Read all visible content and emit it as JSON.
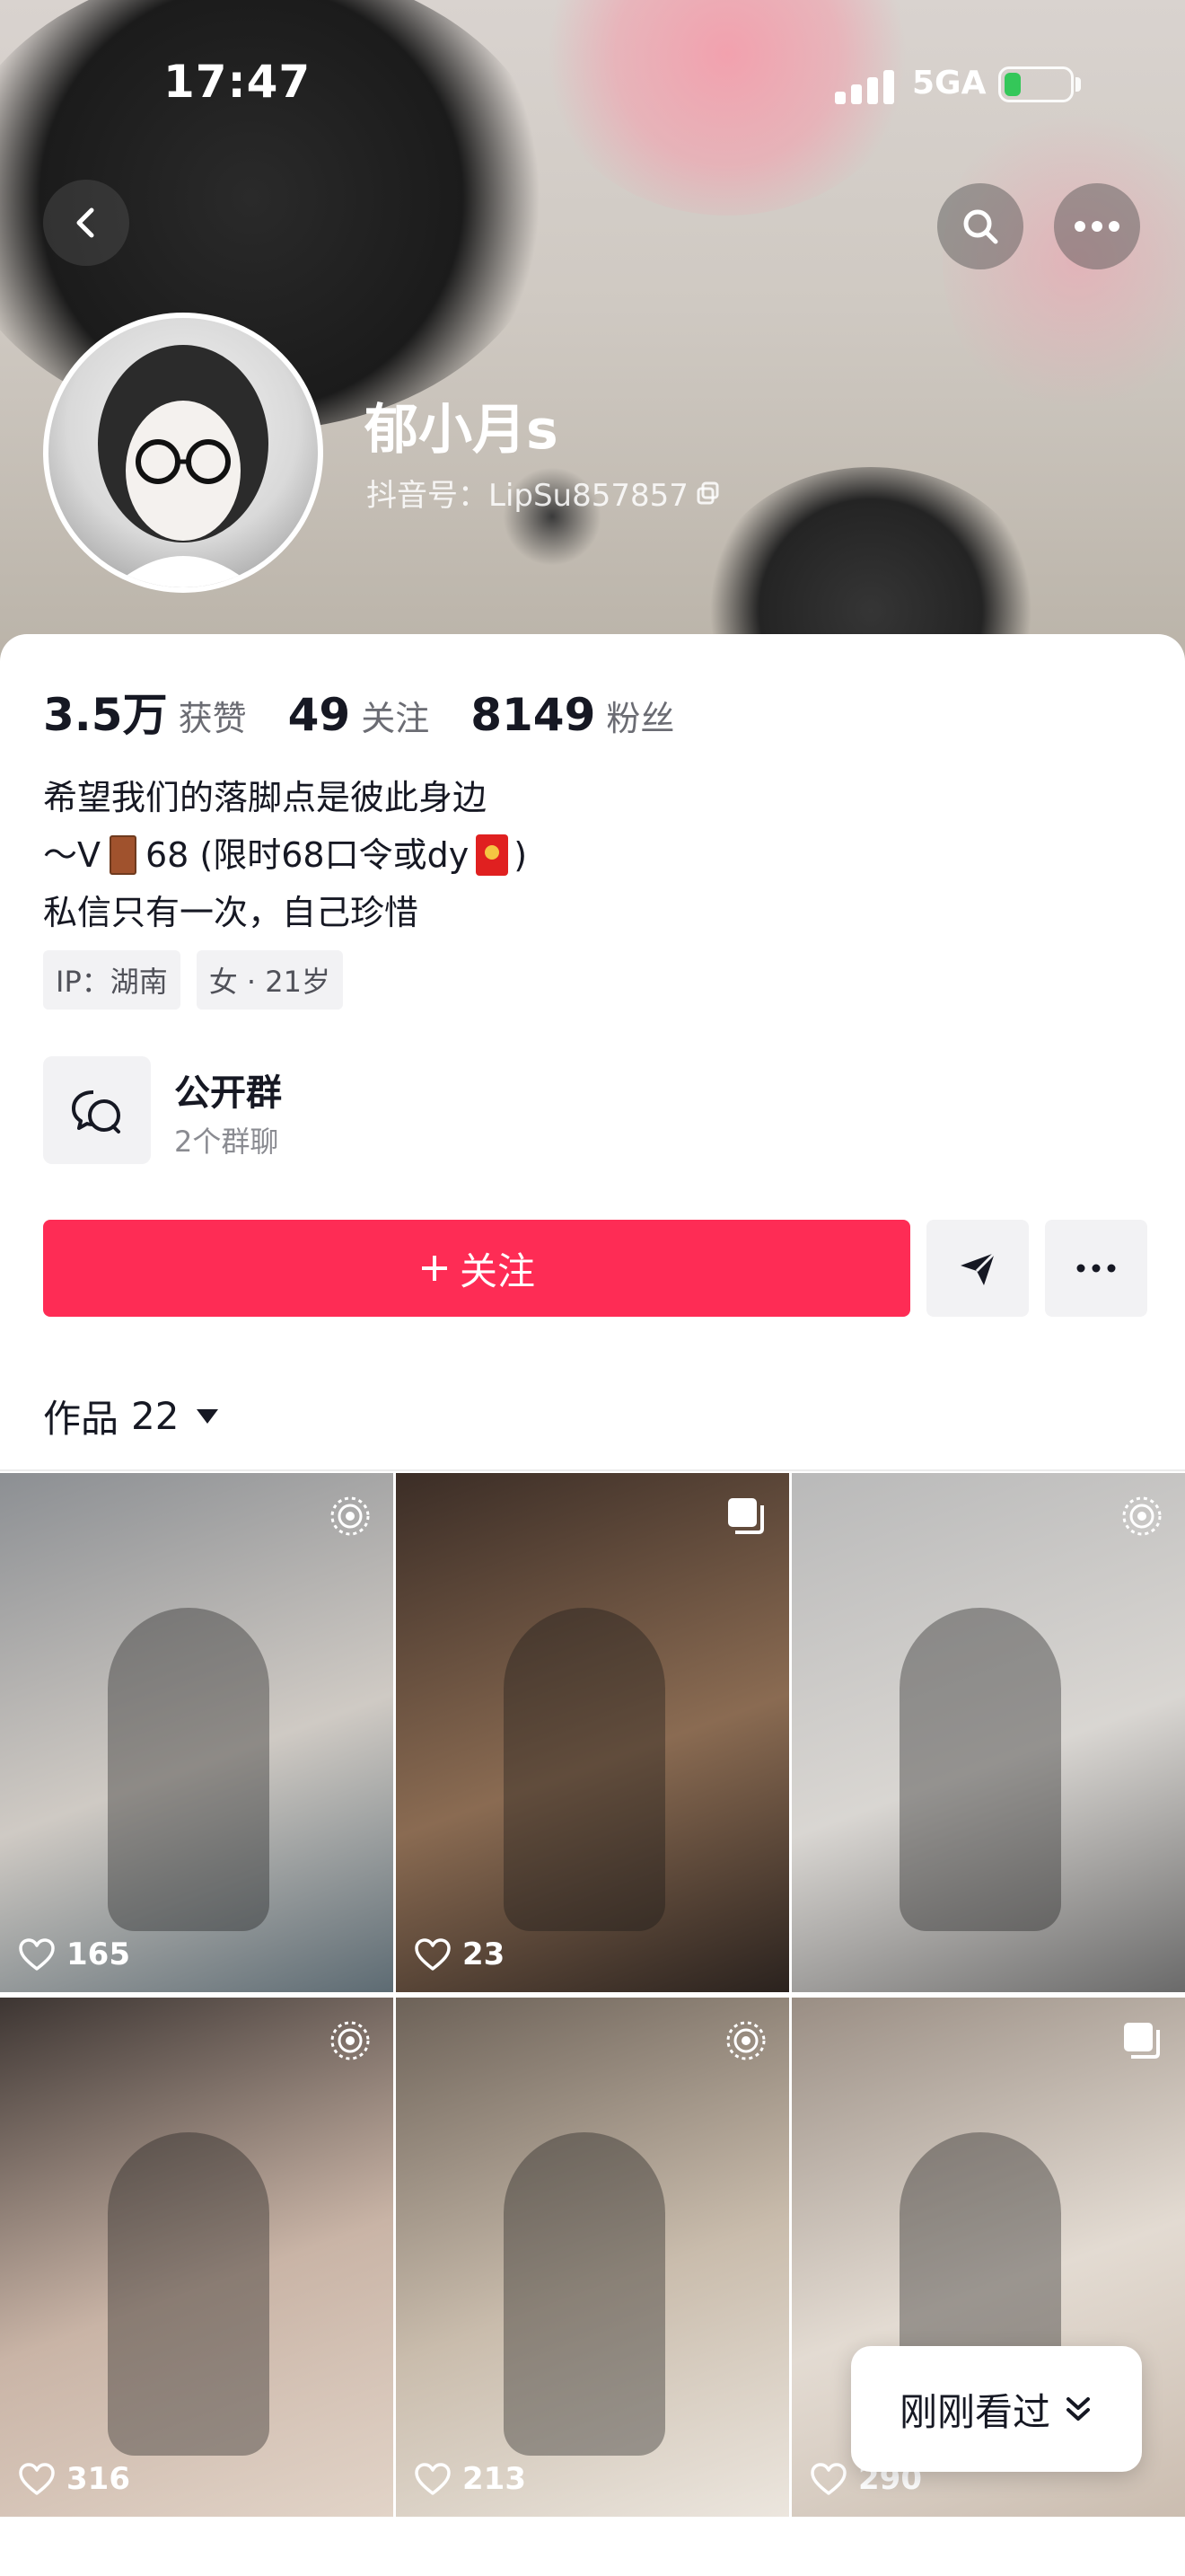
{
  "status_bar": {
    "time": "17:47",
    "network": "5GA"
  },
  "profile": {
    "nickname": "郁小月s",
    "douyin_id": "抖音号：LipSu857857"
  },
  "stats": [
    {
      "value": "3.5万",
      "label": "获赞"
    },
    {
      "value": "49",
      "label": "关注"
    },
    {
      "value": "8149",
      "label": "粉丝"
    }
  ],
  "bio": {
    "line1": "希望我们的落脚点是彼此身边",
    "line2_prefix": "～V",
    "line2_middle": "68 (限时68口令或dy",
    "line2_suffix": ")",
    "line3": "私信只有一次，自己珍惜"
  },
  "tags": [
    "IP：湖南",
    "女 · 21岁"
  ],
  "group": {
    "title": "公开群",
    "subtitle": "2个群聊"
  },
  "actions": {
    "follow_label": "关注"
  },
  "works_tab": {
    "label": "作品",
    "count": "22"
  },
  "videos": [
    {
      "likes": "165",
      "badge": "live-photo-icon",
      "colors": [
        "#8c8f93",
        "#cfcac4",
        "#5d6b73"
      ]
    },
    {
      "likes": "23",
      "badge": "image-stack-icon",
      "colors": [
        "#3b2d26",
        "#8a6b52",
        "#2a221e"
      ]
    },
    {
      "likes": "",
      "badge": "live-photo-icon",
      "colors": [
        "#b9b9b9",
        "#d9d6d2",
        "#6a6a6a"
      ]
    },
    {
      "likes": "316",
      "badge": "live-photo-icon",
      "colors": [
        "#3d3532",
        "#c9b4a6",
        "#e2d4c8"
      ]
    },
    {
      "likes": "213",
      "badge": "live-photo-icon",
      "colors": [
        "#6d6258",
        "#c9bcac",
        "#ece6de"
      ]
    },
    {
      "likes": "290",
      "badge": "image-stack-icon",
      "colors": [
        "#9a8e84",
        "#e3dbd2",
        "#cbbdb0"
      ]
    }
  ],
  "recent_pill": {
    "label": "刚刚看过"
  },
  "colors": {
    "accent": "#fe2c55",
    "text": "#161823",
    "muted": "#8a8b91",
    "chip_bg": "#f2f2f4"
  }
}
